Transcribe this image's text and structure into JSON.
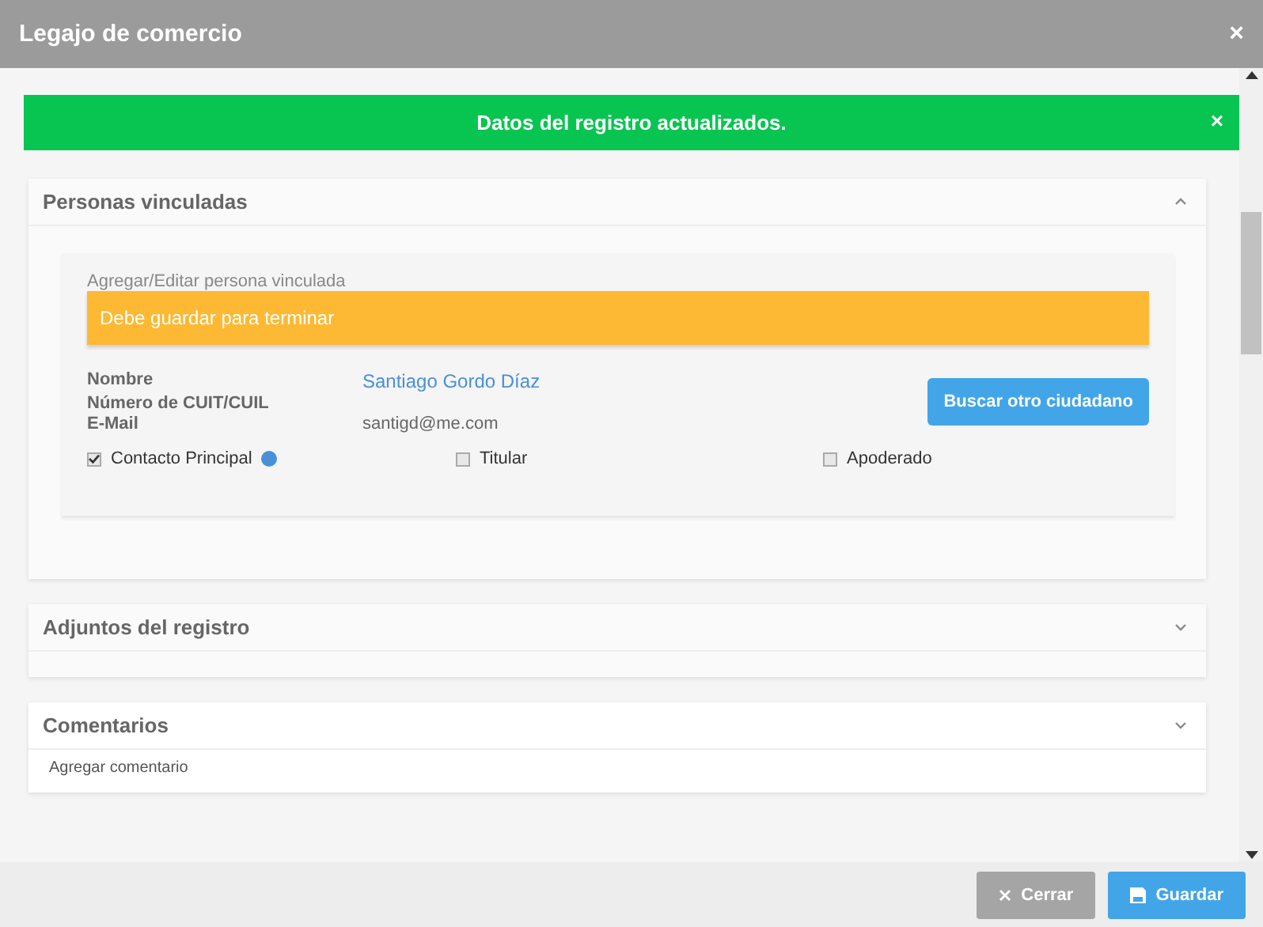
{
  "window": {
    "title": "Legajo de comercio",
    "close": "×"
  },
  "notification": {
    "message": "Datos del registro actualizados.",
    "close": "×"
  },
  "sections": [
    {
      "title": "Personas vinculadas",
      "expanded": true,
      "form": {
        "title": "Agregar/Editar persona vinculada",
        "warning": "Debe guardar para terminar",
        "fields": [
          {
            "label": "Nombre",
            "value": "Santiago Gordo Díaz",
            "kind": "link"
          },
          {
            "label": "Número de CUIT/CUIL",
            "kind": "text"
          },
          {
            "label": "E-Mail",
            "value": "santigd@me.com",
            "kind": "text"
          }
        ],
        "search_button": "Buscar otro ciudadano",
        "checkboxes": [
          {
            "label": "Contacto Principal",
            "checked": true,
            "help": true
          },
          {
            "label": "Titular",
            "checked": false,
            "help": false
          },
          {
            "label": "Apoderado",
            "checked": false,
            "help": false
          }
        ]
      }
    },
    {
      "title": "Adjuntos del registro",
      "expanded": false
    },
    {
      "title": "Comentarios",
      "expanded": false,
      "note": "Agregar comentario"
    }
  ],
  "buttons": [
    {
      "label": "Cerrar",
      "kind": "close"
    },
    {
      "label": "Guardar",
      "kind": "save"
    }
  ]
}
